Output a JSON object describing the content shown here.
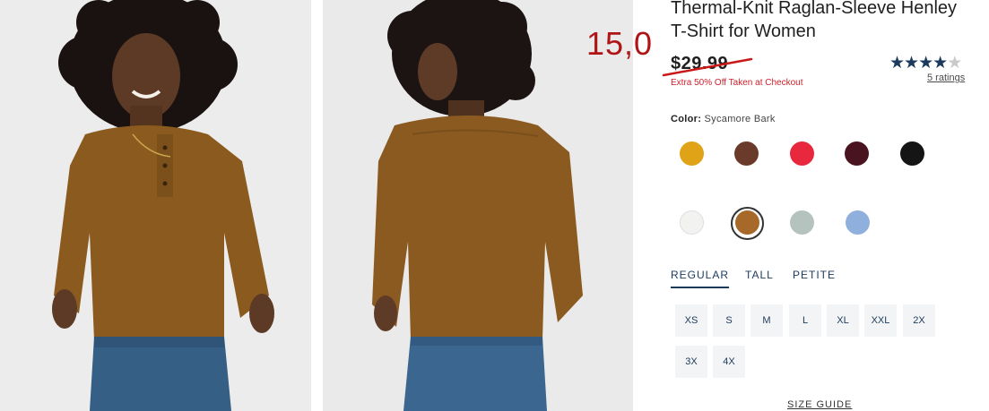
{
  "images": {
    "front_photo": "model-front-photo",
    "back_photo": "model-back-photo"
  },
  "annotation": {
    "handwritten_price": "15,0"
  },
  "product": {
    "title": "Thermal-Knit Raglan-Sleeve Henley T-Shirt for Women",
    "original_price": "$29.99",
    "discount_note": "Extra 50% Off Taken at Checkout",
    "rating": {
      "stars_filled": 4,
      "stars_total": 5,
      "ratings_link": "5 ratings"
    }
  },
  "color": {
    "label": "Color:",
    "selected_name": "Sycamore Bark",
    "swatches": [
      {
        "name": "mustard",
        "hex": "#e0a216",
        "selected": false
      },
      {
        "name": "brown",
        "hex": "#6a3b2a",
        "selected": false
      },
      {
        "name": "red",
        "hex": "#e8283c",
        "selected": false
      },
      {
        "name": "burgundy",
        "hex": "#4a1320",
        "selected": false
      },
      {
        "name": "black",
        "hex": "#151515",
        "selected": false
      },
      {
        "name": "white",
        "hex": "#f2f2f0",
        "selected": false
      },
      {
        "name": "sycamore-bark",
        "hex": "#a6692a",
        "selected": true
      },
      {
        "name": "sage",
        "hex": "#b5c3bf",
        "selected": false
      },
      {
        "name": "light-blue",
        "hex": "#8fb0dc",
        "selected": false
      }
    ]
  },
  "fit_tabs": [
    {
      "label": "REGULAR",
      "active": true
    },
    {
      "label": "TALL",
      "active": false
    },
    {
      "label": "PETITE",
      "active": false
    }
  ],
  "sizes": [
    "XS",
    "S",
    "M",
    "L",
    "XL",
    "XXL",
    "2X",
    "3X",
    "4X"
  ],
  "size_guide_link": "SIZE GUIDE",
  "colors": {
    "accent": "#1b3a5c",
    "sale_red": "#d0202a",
    "annotation_red": "#b01515",
    "size_bg": "#f3f4f6"
  }
}
